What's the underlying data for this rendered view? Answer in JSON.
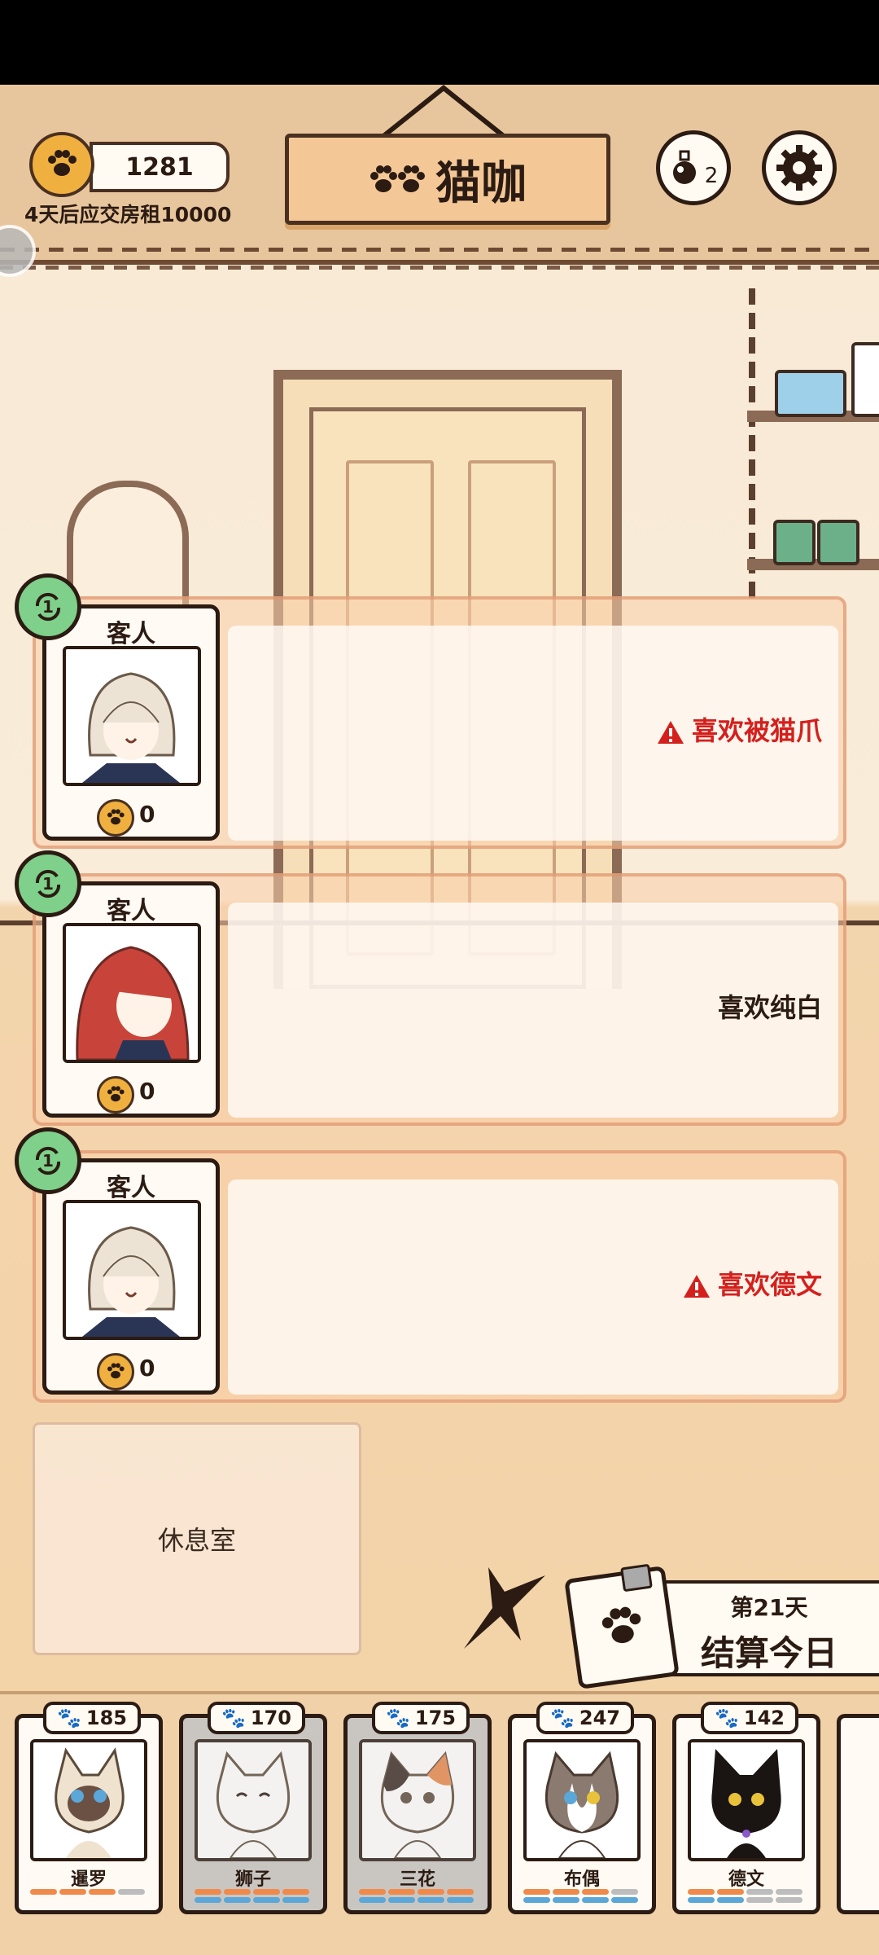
{
  "hud": {
    "money": "1281",
    "rent_notice": "4天后应交房租10000",
    "title": "猫咖",
    "potion_count": "2"
  },
  "customers": [
    {
      "label": "客人",
      "coins": "0",
      "preference": "喜欢被猫爪",
      "warning": true
    },
    {
      "label": "客人",
      "coins": "0",
      "preference": "喜欢纯白",
      "warning": false
    },
    {
      "label": "客人",
      "coins": "0",
      "preference": "喜欢德文",
      "warning": true
    }
  ],
  "lounge": {
    "label": "休息室"
  },
  "settle": {
    "day": "第21天",
    "action": "结算今日"
  },
  "cats": [
    {
      "name": "暹罗",
      "score": "185",
      "tired": false,
      "bars": [
        "#f08a4b",
        "#f08a4b",
        "#f08a4b",
        "#bdbdbd"
      ]
    },
    {
      "name": "狮子",
      "score": "170",
      "tired": true,
      "bars": [
        "#f08a4b",
        "#f08a4b",
        "#f08a4b",
        "#f08a4b",
        "#5aa7d8",
        "#5aa7d8",
        "#5aa7d8",
        "#5aa7d8"
      ]
    },
    {
      "name": "三花",
      "score": "175",
      "tired": true,
      "bars": [
        "#f08a4b",
        "#f08a4b",
        "#f08a4b",
        "#f08a4b",
        "#5aa7d8",
        "#5aa7d8",
        "#5aa7d8",
        "#5aa7d8"
      ]
    },
    {
      "name": "布偶",
      "score": "247",
      "tired": false,
      "bars": [
        "#f08a4b",
        "#f08a4b",
        "#f08a4b",
        "#bdbdbd",
        "#5aa7d8",
        "#5aa7d8",
        "#5aa7d8",
        "#5aa7d8"
      ]
    },
    {
      "name": "德文",
      "score": "142",
      "tired": false,
      "bars": [
        "#f08a4b",
        "#f08a4b",
        "#bdbdbd",
        "#bdbdbd",
        "#5aa7d8",
        "#5aa7d8",
        "#bdbdbd",
        "#bdbdbd"
      ]
    }
  ],
  "colors": {
    "coin": "#f0b040",
    "warning": "#d4201d",
    "refresh": "#7ed08a",
    "outline": "#2b1b12"
  },
  "icons": {
    "coin": "paw-coin-icon",
    "potion": "potion-icon",
    "settings": "gear-icon",
    "refresh": "refresh-icon",
    "warning": "warning-icon",
    "clipboard": "clipboard-icon"
  }
}
